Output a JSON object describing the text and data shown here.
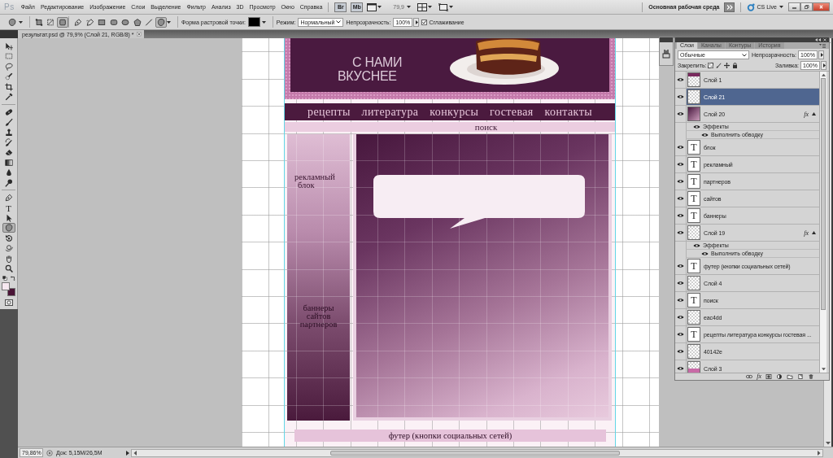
{
  "menu_bar": {
    "logo": "Ps",
    "menus": [
      "Файл",
      "Редактирование",
      "Изображение",
      "Слои",
      "Выделение",
      "Фильтр",
      "Анализ",
      "3D",
      "Просмотр",
      "Окно",
      "Справка"
    ],
    "bridge": "Br",
    "mini_bridge": "Mb",
    "zoom": "79,9",
    "workspace": "Основная рабочая среда",
    "cs_live": "CS Live"
  },
  "options_bar": {
    "modes": [
      {
        "kind": "shape-layers",
        "selected": false
      },
      {
        "kind": "paths",
        "selected": false
      },
      {
        "kind": "fill-pixels",
        "selected": true
      }
    ],
    "shapes": [
      {
        "kind": "pen",
        "selected": false
      },
      {
        "kind": "freeform-pen",
        "selected": false
      },
      {
        "kind": "rectangle",
        "selected": false
      },
      {
        "kind": "rounded-rectangle",
        "selected": false
      },
      {
        "kind": "ellipse",
        "selected": false
      },
      {
        "kind": "polygon",
        "selected": false
      },
      {
        "kind": "line",
        "selected": false
      },
      {
        "kind": "custom-shape",
        "selected": true
      }
    ],
    "swatch_label": "Форма растровой точки:",
    "swatch": {
      "color": "#000000"
    },
    "mode_label": "Режим:",
    "mode": "Нормальный",
    "opacity_label": "Непрозрачность:",
    "opacity": "100%",
    "antialias": {
      "label": "Сглаживание",
      "checked": true
    }
  },
  "document_tab": {
    "title": "результат.psd @ 79,9% (Слой 21, RGB/8) *"
  },
  "tool_groups": [
    {
      "tools": [
        {
          "kind": "move",
          "selected": false
        },
        {
          "kind": "marquee",
          "selected": false
        },
        {
          "kind": "lasso",
          "selected": false
        },
        {
          "kind": "quick-selection",
          "selected": false
        },
        {
          "kind": "crop",
          "selected": false
        },
        {
          "kind": "eyedropper",
          "selected": false
        }
      ]
    },
    {
      "tools": [
        {
          "kind": "spot-healing",
          "selected": false
        },
        {
          "kind": "brush",
          "selected": false
        },
        {
          "kind": "stamp",
          "selected": false
        },
        {
          "kind": "history-brush",
          "selected": false
        },
        {
          "kind": "eraser",
          "selected": false
        },
        {
          "kind": "gradient",
          "selected": false
        },
        {
          "kind": "blur",
          "selected": false
        },
        {
          "kind": "dodge",
          "selected": false
        }
      ]
    },
    {
      "tools": [
        {
          "kind": "pen",
          "selected": false
        },
        {
          "kind": "type",
          "label": "T",
          "selected": false
        },
        {
          "kind": "path-selection",
          "selected": false
        },
        {
          "kind": "custom-shape",
          "selected": true
        },
        {
          "kind": "rotate",
          "selected": false
        },
        {
          "kind": "orbit",
          "selected": false
        },
        {
          "kind": "hand",
          "selected": false
        },
        {
          "kind": "zoom",
          "selected": false
        }
      ]
    }
  ],
  "colors": [
    {
      "kind": "foreground",
      "color": "#f6e8f0"
    },
    {
      "kind": "background",
      "color": "#4a1436"
    }
  ],
  "design": {
    "slogan": [
      "С НАМИ",
      "ВКУСНЕЕ"
    ],
    "nav": [
      "рецепты",
      "литература",
      "конкурсы",
      "гостевая",
      "контакты"
    ],
    "search": "поиск",
    "ad_block": [
      "рекламный",
      "блок"
    ],
    "banners": [
      "баннеры",
      "сайтов",
      "партнеров"
    ],
    "footer": "футер (кнопки социальных сетей)"
  },
  "layers_panel": {
    "tabs": [
      {
        "label": "Слои",
        "selected": true
      },
      {
        "label": "Каналы",
        "selected": false
      },
      {
        "label": "Контуры",
        "selected": false
      },
      {
        "label": "История",
        "selected": false
      }
    ],
    "blend_mode": "Обычные",
    "opacity_label": "Непрозрачность:",
    "opacity": "100%",
    "lock_label": "Закрепить:",
    "fill_label": "Заливка:",
    "fill": "100%",
    "layers": [
      {
        "name": "Слой 1",
        "kind": "image",
        "selected": false,
        "visible": true
      },
      {
        "name": "Слой 21",
        "kind": "raster",
        "selected": true,
        "visible": true
      },
      {
        "name": "Слой 20",
        "kind": "gradient",
        "selected": false,
        "visible": true,
        "fx": "fx",
        "expanded": true,
        "effects": {
          "label": "Эффекты",
          "visible": true,
          "items": [
            {
              "label": "Выполнить обводку",
              "visible": true
            }
          ]
        }
      },
      {
        "name": "блок",
        "kind": "text",
        "thumbnail": "T",
        "selected": false,
        "visible": true
      },
      {
        "name": "рекламный",
        "kind": "text",
        "thumbnail": "T",
        "selected": false,
        "visible": true
      },
      {
        "name": "партнеров",
        "kind": "text",
        "thumbnail": "T",
        "selected": false,
        "visible": true
      },
      {
        "name": "сайтов",
        "kind": "text",
        "thumbnail": "T",
        "selected": false,
        "visible": true
      },
      {
        "name": "баннеры",
        "kind": "text",
        "thumbnail": "T",
        "selected": false,
        "visible": true
      },
      {
        "name": "Слой 19",
        "kind": "raster",
        "selected": false,
        "visible": true,
        "fx": "fx",
        "expanded": true,
        "effects": {
          "label": "Эффекты",
          "visible": true,
          "items": [
            {
              "label": "Выполнить обводку",
              "visible": true
            }
          ]
        }
      },
      {
        "name": "футер (кнопки социальных сетей)",
        "kind": "text",
        "thumbnail": "T",
        "selected": false,
        "visible": true
      },
      {
        "name": "Слой 4",
        "kind": "raster",
        "selected": false,
        "visible": true
      },
      {
        "name": "поиск",
        "kind": "text",
        "thumbnail": "T",
        "selected": false,
        "visible": true
      },
      {
        "name": "eac4dd",
        "kind": "raster",
        "selected": false,
        "visible": true
      },
      {
        "name": "рецепты литература конкурсы гостевая ...",
        "kind": "text",
        "thumbnail": "T",
        "selected": false,
        "visible": true
      },
      {
        "name": "40142e",
        "kind": "raster",
        "selected": false,
        "visible": true
      },
      {
        "name": "Слой 3",
        "kind": "fill",
        "selected": false,
        "visible": true
      }
    ],
    "footer_fx": "fx"
  },
  "status_bar": {
    "zoom": "79,86%",
    "doc_size": "Док: 5,15M/26,5M"
  }
}
